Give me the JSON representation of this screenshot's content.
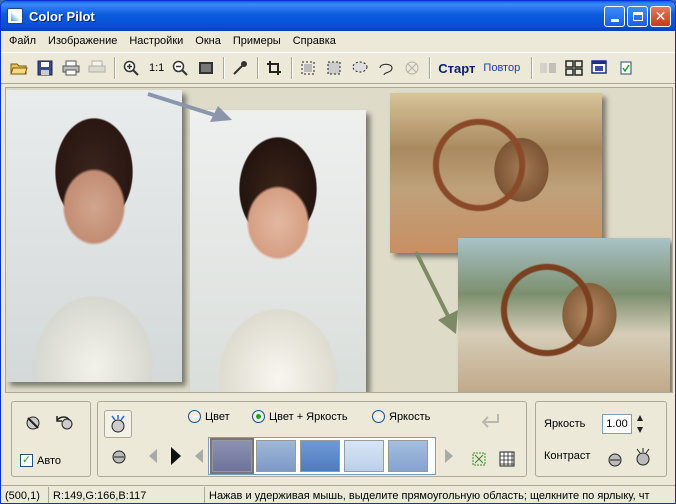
{
  "window": {
    "title": "Color Pilot"
  },
  "menu": {
    "items": [
      "Файл",
      "Изображение",
      "Настройки",
      "Окна",
      "Примеры",
      "Справка"
    ]
  },
  "toolbar": {
    "zoom_label": "1:1",
    "start_label": "Старт",
    "repeat_label": "Повтор",
    "icons": [
      "open-icon",
      "save-icon",
      "print-icon",
      "print-preview-icon",
      "zoom-in-icon",
      "zoom-out-icon",
      "fit-screen-icon",
      "eyedropper-icon",
      "crop-icon",
      "select-rect-icon",
      "select-fill-icon",
      "lasso-icon",
      "freehand-lasso-icon",
      "clear-selection-icon",
      "compare-icon",
      "tile-icon",
      "window-icon"
    ]
  },
  "bottom": {
    "auto_label": "Авто",
    "auto_checked": true,
    "mode_options": [
      "Цвет",
      "Цвет + Яркость",
      "Яркость"
    ],
    "mode_selected": "Цвет + Яркость",
    "brightness_label": "Яркость",
    "brightness_value": "1.00",
    "contrast_label": "Контраст"
  },
  "status": {
    "coords": "(500,1)",
    "rgb": "R:149,G:166,B:117",
    "hint": "Нажав и удерживая мышь, выделите прямоугольную область; щелкните по ярлыку, чт"
  },
  "colors": {
    "title_bar": "#0a5ee9",
    "accent_text": "#0a1f6e",
    "check": "#21a121"
  }
}
